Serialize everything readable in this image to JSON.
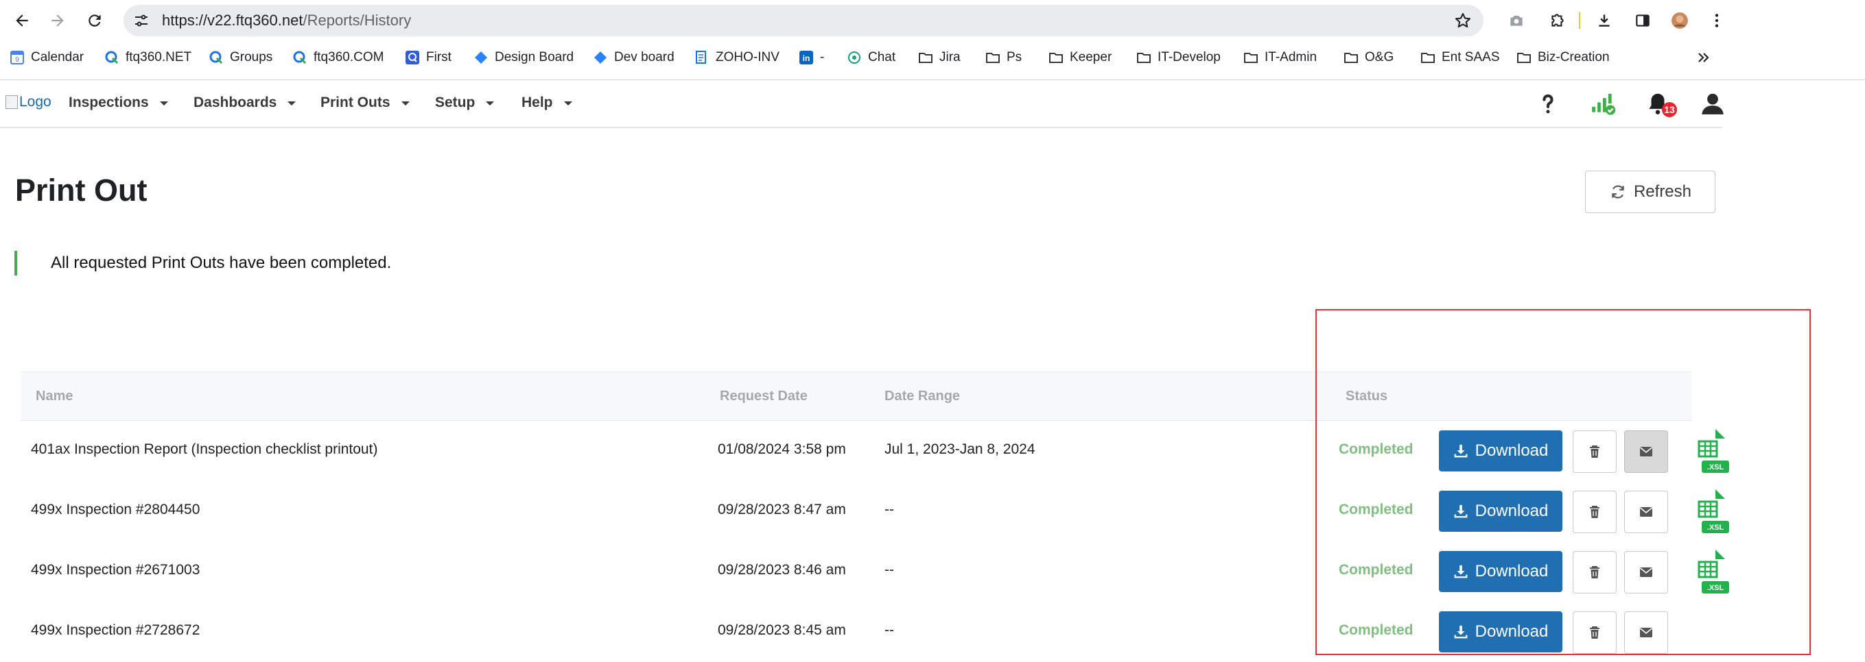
{
  "browser": {
    "url_host": "https://v22.ftq360.net",
    "url_path": "/Reports/History",
    "bookmarks": [
      {
        "label": "Calendar",
        "icon": "calendar-icon"
      },
      {
        "label": "ftq360.NET",
        "icon": "ftq-logo-icon"
      },
      {
        "label": "Groups",
        "icon": "ftq-logo-icon"
      },
      {
        "label": "ftq360.COM",
        "icon": "ftq-logo-icon"
      },
      {
        "label": "First",
        "icon": "q-logo-icon"
      },
      {
        "label": "Design Board",
        "icon": "diamond-icon"
      },
      {
        "label": "Dev board",
        "icon": "diamond-icon"
      },
      {
        "label": "ZOHO-INV",
        "icon": "document-icon"
      },
      {
        "label": "-",
        "icon": "linkedin-icon"
      },
      {
        "label": "Chat",
        "icon": "chat-icon"
      },
      {
        "label": "Jira",
        "icon": "folder-icon"
      },
      {
        "label": "Ps",
        "icon": "folder-icon"
      },
      {
        "label": "Keeper",
        "icon": "folder-icon"
      },
      {
        "label": "IT-Develop",
        "icon": "folder-icon"
      },
      {
        "label": "IT-Admin",
        "icon": "folder-icon"
      },
      {
        "label": "O&G",
        "icon": "folder-icon"
      },
      {
        "label": "Ent SAAS",
        "icon": "folder-icon"
      },
      {
        "label": "Biz-Creation",
        "icon": "folder-icon"
      }
    ]
  },
  "nav": {
    "logo_alt": "Logo",
    "items": [
      "Inspections",
      "Dashboards",
      "Print Outs",
      "Setup",
      "Help"
    ],
    "notification_count": "13"
  },
  "page": {
    "title": "Print Out",
    "refresh_label": "Refresh",
    "alert": "All requested Print Outs have been completed."
  },
  "table": {
    "headers": {
      "name": "Name",
      "request_date": "Request Date",
      "date_range": "Date Range",
      "status": "Status"
    },
    "download_label": "Download",
    "rows": [
      {
        "name": "401ax Inspection Report (Inspection checklist printout)",
        "request_date": "01/08/2024 3:58 pm",
        "date_range": "Jul 1, 2023-Jan 8, 2024",
        "status": "Completed",
        "has_xsl": true
      },
      {
        "name": "499x Inspection #2804450",
        "request_date": "09/28/2023 8:47 am",
        "date_range": "--",
        "status": "Completed",
        "has_xsl": true
      },
      {
        "name": "499x Inspection #2671003",
        "request_date": "09/28/2023 8:46 am",
        "date_range": "--",
        "status": "Completed",
        "has_xsl": true
      },
      {
        "name": "499x Inspection #2728672",
        "request_date": "09/28/2023 8:45 am",
        "date_range": "--",
        "status": "Completed",
        "has_xsl": false
      }
    ]
  },
  "colors": {
    "download_button": "#1f6fb2",
    "status_completed": "#7fbf7f",
    "highlight_box": "#e0343a",
    "alert_accent": "#4aa954"
  }
}
